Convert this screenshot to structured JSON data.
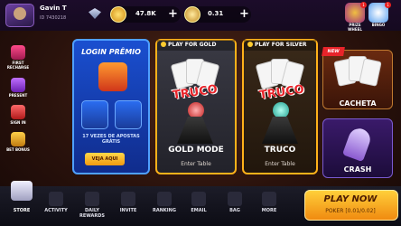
{
  "player": {
    "name": "Gavin T",
    "id": "ID 7430218"
  },
  "currency": {
    "gold_amount": "47.8K",
    "silver_amount": "0.31",
    "plus_symbol": "+"
  },
  "top_icons": {
    "prize_wheel": "PRIZE\nWHEEL",
    "prize_wheel_label": "PRIZE WHEEL",
    "bingo_label": "BINGO",
    "prize_badge": "1",
    "bingo_badge": "1"
  },
  "sidebar": [
    {
      "label": "FIRST RECHARGE",
      "icon": "gift-box-icon"
    },
    {
      "label": "PRESENT",
      "icon": "present-icon"
    },
    {
      "label": "SIGN IN",
      "icon": "calendar-icon"
    },
    {
      "label": "BET BONUS",
      "icon": "bonus-icon"
    }
  ],
  "promo": {
    "title": "LOGIN PRÊMIO",
    "text": "17 VEZES DE APOSTAS GRÁTIS",
    "cta": "VEJA AQUI"
  },
  "modes": {
    "gold": {
      "tag": "PLAY FOR GOLD",
      "art_text": "TRUCO",
      "name": "GOLD MODE",
      "action": "Enter Table"
    },
    "silver": {
      "tag": "PLAY FOR SILVER",
      "art_text": "TRUCO",
      "name": "TRUCO",
      "action": "Enter Table"
    }
  },
  "side_games": {
    "new_badge": "NEW",
    "cacheta": "CACHETA",
    "crash": "CRASH"
  },
  "bottom_nav": {
    "store": "STORE",
    "items": [
      {
        "label": "ACTIVITY",
        "icon": "activity-icon"
      },
      {
        "label": "DAILY REWARDS",
        "icon": "daily-rewards-icon"
      },
      {
        "label": "INVITE",
        "icon": "invite-icon"
      },
      {
        "label": "RANKING",
        "icon": "ranking-icon"
      },
      {
        "label": "EMAIL",
        "icon": "email-icon"
      },
      {
        "label": "BAG",
        "icon": "bag-icon"
      },
      {
        "label": "MORE",
        "icon": "more-icon"
      }
    ]
  },
  "play_now": {
    "title": "PLAY NOW",
    "subtitle": "POKER [0.01/0.02]"
  },
  "colors": {
    "gold_border": "#ffb21a",
    "promo_blue": "#1a4fd0",
    "truco_red": "#e8242a",
    "play_now": "#f5b32a"
  }
}
